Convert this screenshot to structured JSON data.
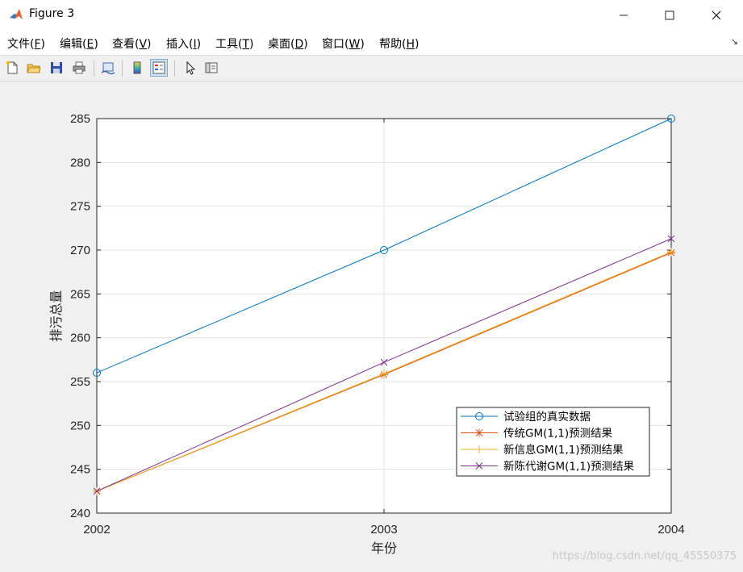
{
  "window": {
    "title": "Figure 3"
  },
  "menu": [
    {
      "label": "文件(",
      "key": "F",
      "suffix": ")"
    },
    {
      "label": "编辑(",
      "key": "E",
      "suffix": ")"
    },
    {
      "label": "查看(",
      "key": "V",
      "suffix": ")"
    },
    {
      "label": "插入(",
      "key": "I",
      "suffix": ")"
    },
    {
      "label": "工具(",
      "key": "T",
      "suffix": ")"
    },
    {
      "label": "桌面(",
      "key": "D",
      "suffix": ")"
    },
    {
      "label": "窗口(",
      "key": "W",
      "suffix": ")"
    },
    {
      "label": "帮助(",
      "key": "H",
      "suffix": ")"
    }
  ],
  "toolbar": [
    "new-figure-icon",
    "open-file-icon",
    "save-icon",
    "print-icon",
    "link-plot-icon",
    "insert-colorbar-icon",
    "insert-legend-icon",
    "edit-plot-arrow-icon",
    "property-inspector-icon"
  ],
  "watermark": "https://blog.csdn.net/qq_45550375",
  "chart_data": {
    "type": "line",
    "xlabel": "年份",
    "ylabel": "排污总量",
    "x": [
      2002,
      2003,
      2004
    ],
    "xticks": [
      "2002",
      "2003",
      "2004"
    ],
    "yticks": [
      "240",
      "245",
      "250",
      "255",
      "260",
      "265",
      "270",
      "275",
      "280",
      "285"
    ],
    "xlim": [
      2002,
      2004
    ],
    "ylim": [
      240,
      285
    ],
    "grid": true,
    "legend_position": "lower-right",
    "series": [
      {
        "name": "试验组的真实数据",
        "values": [
          256,
          270,
          285
        ],
        "marker": "circle",
        "color": "#0072bd"
      },
      {
        "name": "传统GM(1,1)预测结果",
        "values": [
          242.5,
          255.8,
          269.7
        ],
        "marker": "asterisk",
        "color": "#d95319"
      },
      {
        "name": "新信息GM(1,1)预测结果",
        "values": [
          242.5,
          255.9,
          269.8
        ],
        "marker": "plus",
        "color": "#edb120"
      },
      {
        "name": "新陈代谢GM(1,1)预测结果",
        "values": [
          242.5,
          257.2,
          271.3
        ],
        "marker": "cross",
        "color": "#7e2f8e"
      }
    ]
  }
}
